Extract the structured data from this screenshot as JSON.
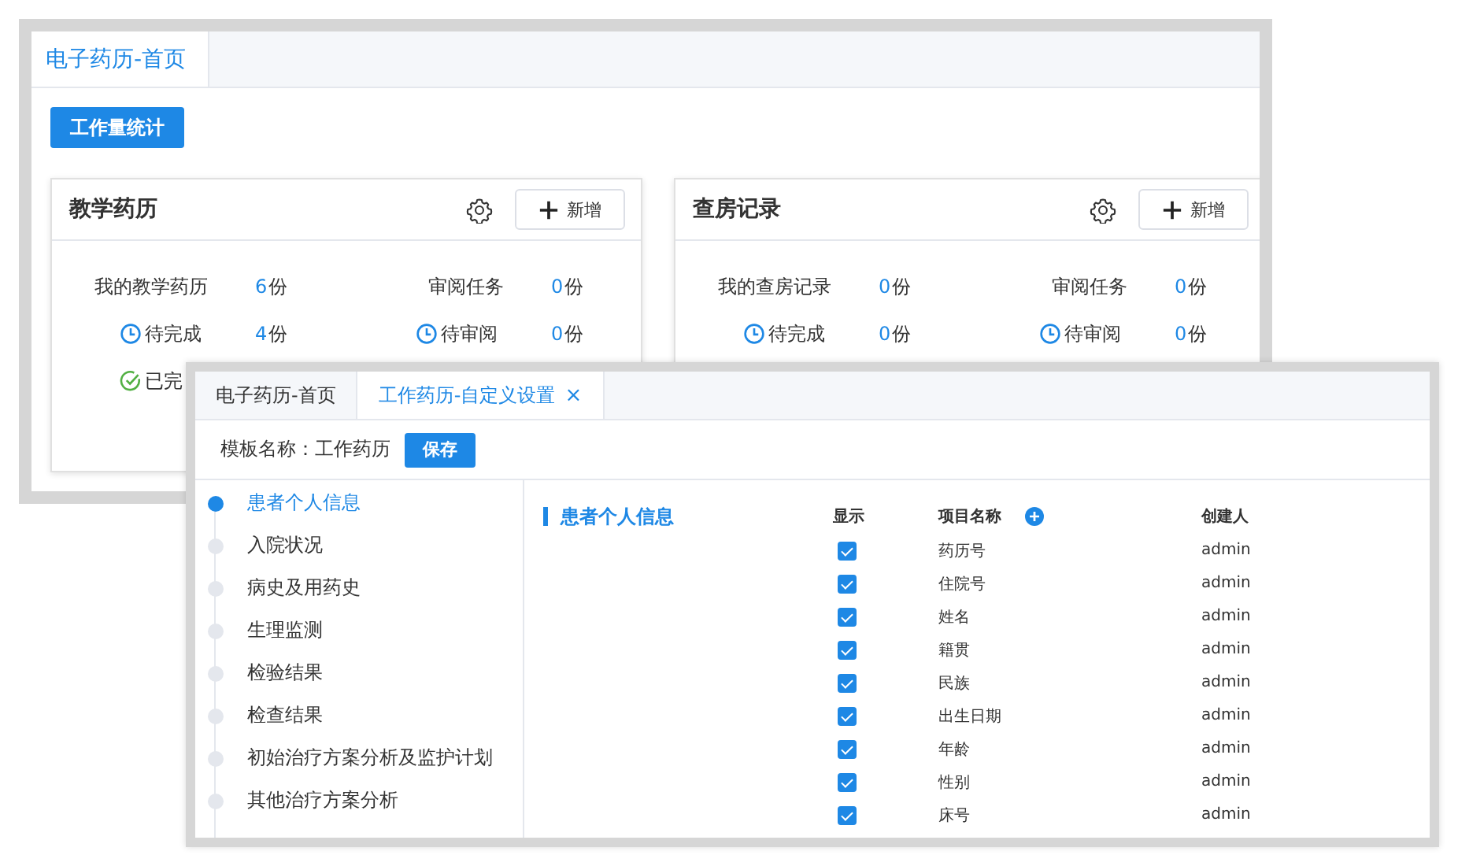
{
  "back_window": {
    "tabs": [
      {
        "label": "电子药历-首页",
        "selected": true
      }
    ],
    "stats_button": "工作量统计",
    "cards": [
      {
        "title": "教学药历",
        "add_button": "新增",
        "stats": [
          {
            "label": "我的教学药历",
            "value": "6",
            "unit": "份",
            "kind": "total"
          },
          {
            "label": "审阅任务",
            "value": "0",
            "unit": "份",
            "kind": "total"
          },
          {
            "label": "待完成",
            "value": "4",
            "unit": "份",
            "kind": "pending"
          },
          {
            "label": "待审阅",
            "value": "0",
            "unit": "份",
            "kind": "pending"
          },
          {
            "label": "已完",
            "kind": "done"
          }
        ]
      },
      {
        "title": "查房记录",
        "add_button": "新增",
        "stats": [
          {
            "label": "我的查房记录",
            "value": "0",
            "unit": "份",
            "kind": "total"
          },
          {
            "label": "审阅任务",
            "value": "0",
            "unit": "份",
            "kind": "total"
          },
          {
            "label": "待完成",
            "value": "0",
            "unit": "份",
            "kind": "pending"
          },
          {
            "label": "待审阅",
            "value": "0",
            "unit": "份",
            "kind": "pending"
          }
        ]
      }
    ]
  },
  "front_window": {
    "tabs": [
      {
        "label": "电子药历-首页",
        "selected": false
      },
      {
        "label": "工作药历-自定义设置",
        "selected": true,
        "close": "×"
      }
    ],
    "template_label": "模板名称：",
    "template_name": "工作药历",
    "save_button": "保存",
    "sections": [
      {
        "label": "患者个人信息",
        "selected": true
      },
      {
        "label": "入院状况",
        "selected": false
      },
      {
        "label": "病史及用药史",
        "selected": false
      },
      {
        "label": "生理监测",
        "selected": false
      },
      {
        "label": "检验结果",
        "selected": false
      },
      {
        "label": "检查结果",
        "selected": false
      },
      {
        "label": "初始治疗方案分析及监护计划",
        "selected": false
      },
      {
        "label": "其他治疗方案分析",
        "selected": false
      }
    ],
    "panel": {
      "title": "患者个人信息",
      "columns": [
        "显示",
        "项目名称",
        "创建人"
      ],
      "rows": [
        {
          "shown": true,
          "name": "药历号",
          "creator": "admin"
        },
        {
          "shown": true,
          "name": "住院号",
          "creator": "admin"
        },
        {
          "shown": true,
          "name": "姓名",
          "creator": "admin"
        },
        {
          "shown": true,
          "name": "籍贯",
          "creator": "admin"
        },
        {
          "shown": true,
          "name": "民族",
          "creator": "admin"
        },
        {
          "shown": true,
          "name": "出生日期",
          "creator": "admin"
        },
        {
          "shown": true,
          "name": "年龄",
          "creator": "admin"
        },
        {
          "shown": true,
          "name": "性别",
          "creator": "admin"
        },
        {
          "shown": true,
          "name": "床号",
          "creator": "admin"
        }
      ]
    }
  }
}
